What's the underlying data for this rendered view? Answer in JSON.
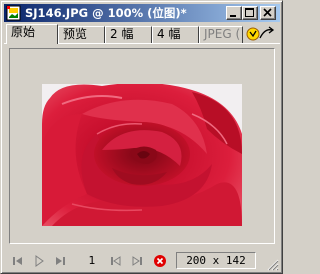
{
  "window": {
    "title": "SJ146.JPG @ 100% (位图)*"
  },
  "tabs": [
    {
      "label": "原始",
      "active": true
    },
    {
      "label": "预览",
      "active": false
    },
    {
      "label": "2 幅",
      "active": false
    },
    {
      "label": "4 幅",
      "active": false
    },
    {
      "label": "JPEG (",
      "active": false
    }
  ],
  "status": {
    "page": "1",
    "image_size": "200 x 142"
  },
  "colors": {
    "title_gradient_start": "#0a246a",
    "title_gradient_end": "#a6caf0",
    "window_face": "#d4d0c8",
    "rose_red": "#c8102e"
  },
  "icons": {
    "app": "fireworks-document-icon",
    "minimize": "minimize-icon",
    "maximize": "maximize-icon",
    "close": "close-icon",
    "optimize": "optimize-export-icon",
    "first": "first-frame-icon",
    "play": "play-icon",
    "last": "last-frame-icon",
    "prev": "previous-frame-icon",
    "next": "next-frame-icon",
    "stop": "stop-icon",
    "grip": "resize-grip-icon"
  }
}
